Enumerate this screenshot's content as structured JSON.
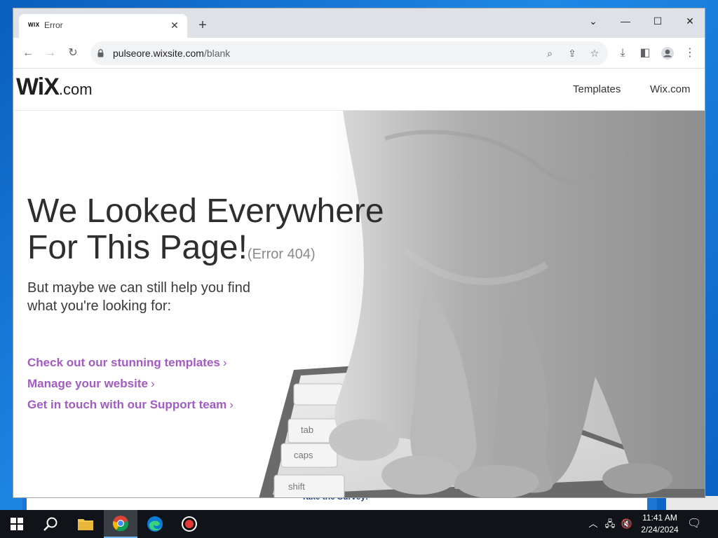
{
  "browser": {
    "tab_title": "Error",
    "tab_favicon": "WIX",
    "new_tab_label": "+",
    "url_domain": "pulseore.wixsite.com",
    "url_path": "/blank",
    "icons": [
      "back-icon",
      "forward-icon",
      "reload-icon",
      "lock-icon",
      "zoom-icon",
      "share-icon",
      "star-icon",
      "download-icon",
      "side-panel-icon",
      "profile-icon",
      "menu-icon"
    ]
  },
  "site": {
    "logo_main": "WiX",
    "logo_suffix": ".com",
    "nav": {
      "templates": "Templates",
      "wix_com": "Wix.com"
    },
    "headline_line1": "We Looked Everywhere",
    "headline_line2": "For This Page!",
    "error_code": "(Error 404)",
    "subline": "But maybe we can still help you find what you're looking for:",
    "links": [
      {
        "label": "Check out our stunning templates",
        "chevron": "›"
      },
      {
        "label": "Manage your website",
        "chevron": "›"
      },
      {
        "label": "Get in touch with our Support team",
        "chevron": "›"
      }
    ],
    "keyboard_keys": [
      "tab",
      "caps",
      "shift"
    ]
  },
  "desktop": {
    "background_window_text": "Take the Survey!"
  },
  "taskbar": {
    "apps": [
      "start-icon",
      "search-icon",
      "file-explorer-icon",
      "chrome-icon",
      "edge-icon",
      "record-icon"
    ],
    "time": "11:41 AM",
    "date": "2/24/2024"
  },
  "colors": {
    "link": "#a35ac4",
    "headline": "#2e2e2e",
    "taskbar": "#101418",
    "desktop": "#1565c0"
  }
}
